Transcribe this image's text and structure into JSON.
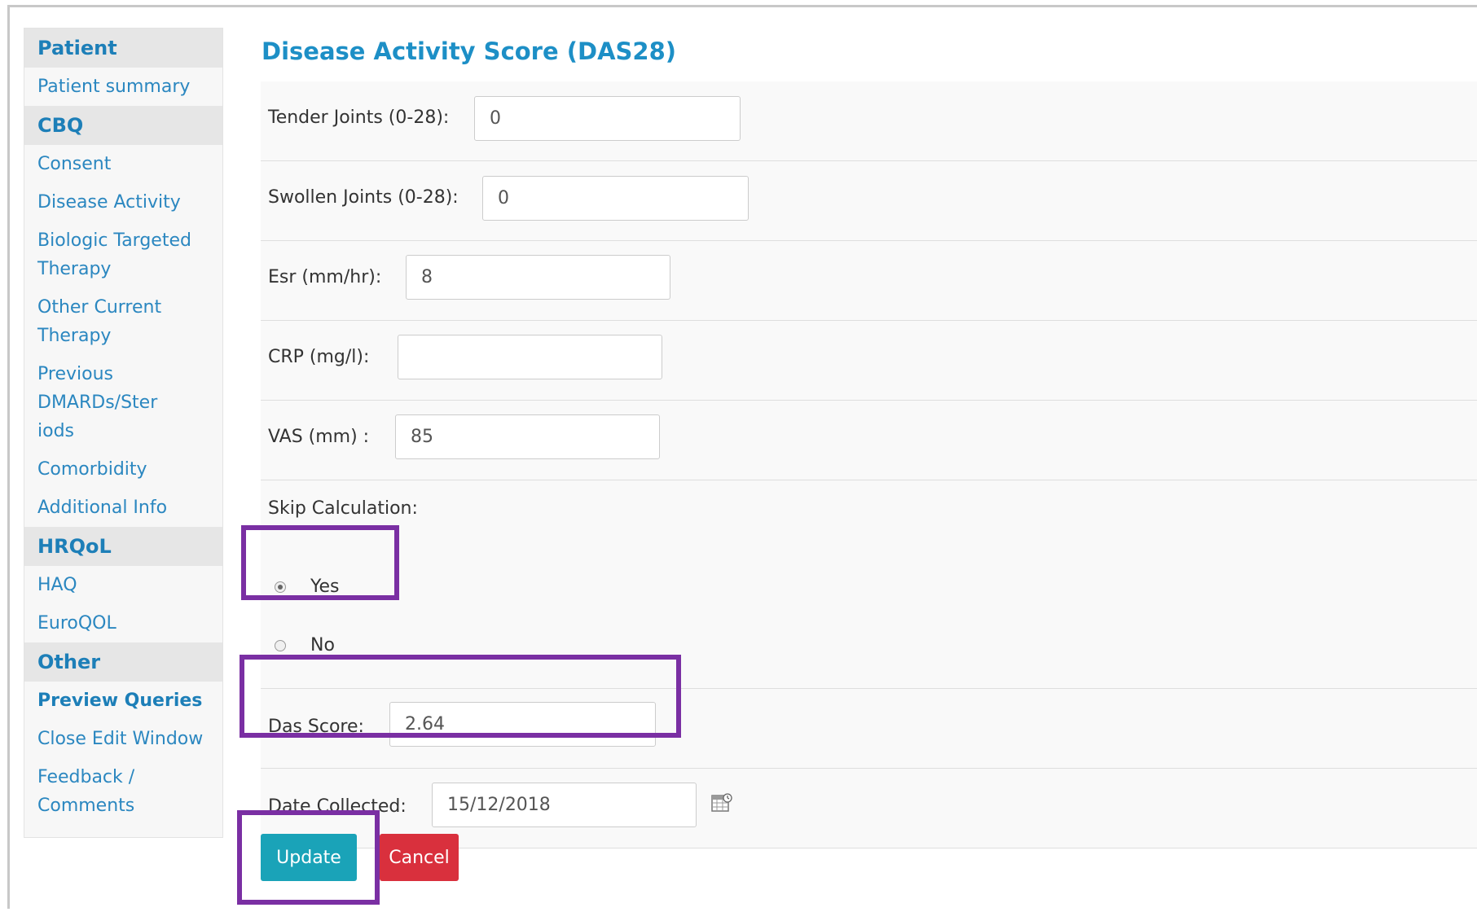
{
  "sidebar": {
    "sections": [
      {
        "heading": "Patient",
        "items": [
          "Patient summary"
        ]
      },
      {
        "heading": "CBQ",
        "items": [
          "Consent",
          "Disease Activity",
          "Biologic Targeted Therapy",
          "Other Current Therapy",
          "Previous DMARDs/Steriods",
          "Comorbidity",
          "Additional Info"
        ]
      },
      {
        "heading": "HRQoL",
        "items": [
          "HAQ",
          "EuroQOL"
        ]
      },
      {
        "heading": "Other",
        "items": [
          "Preview Queries",
          "Close Edit Window",
          "Feedback / Comments"
        ]
      }
    ]
  },
  "form": {
    "title": "Disease Activity Score (DAS28)",
    "tender_label": "Tender Joints (0-28):",
    "tender_value": "0",
    "swollen_label": "Swollen Joints (0-28):",
    "swollen_value": "0",
    "esr_label": "Esr (mm/hr):",
    "esr_value": "8",
    "crp_label": "CRP (mg/l):",
    "crp_value": "",
    "vas_label": "VAS (mm) :",
    "vas_value": "85",
    "skip_label": "Skip Calculation:",
    "skip_options": [
      "Yes",
      "No"
    ],
    "skip_selected": "Yes",
    "das_label": "Das Score:",
    "das_value": "2.64",
    "date_label": "Date Collected:",
    "date_value": "15/12/2018"
  },
  "buttons": {
    "update": "Update",
    "cancel": "Cancel"
  },
  "colors": {
    "update_bg": "#1aa3b8",
    "cancel_bg": "#d9303d",
    "highlight": "#7a2fa3",
    "link": "#2b87c0"
  }
}
